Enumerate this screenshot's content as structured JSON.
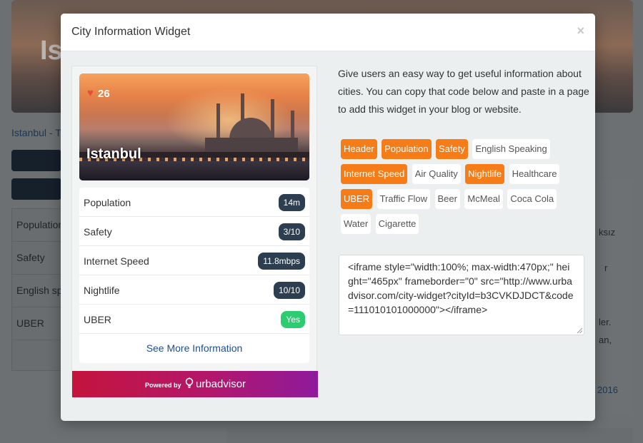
{
  "background": {
    "hero_title": "Ista",
    "breadcrumb": "Istanbul - T",
    "side_rows": [
      "Population",
      "Safety",
      "English sp",
      "UBER"
    ],
    "right_texts": [
      "ksız",
      "r",
      "ler.",
      "an,",
      "2016"
    ]
  },
  "modal": {
    "title": "City Information Widget",
    "close": "×"
  },
  "widget": {
    "likes": "26",
    "city": "Istanbul",
    "stats": [
      {
        "label": "Population",
        "value": "14m",
        "color": "#2c3e50"
      },
      {
        "label": "Safety",
        "value": "3/10",
        "color": "#2c3e50"
      },
      {
        "label": "Internet Speed",
        "value": "11.8mbps",
        "color": "#2c3e50"
      },
      {
        "label": "Nightlife",
        "value": "10/10",
        "color": "#2c3e50"
      },
      {
        "label": "UBER",
        "value": "Yes",
        "color": "#2ecc71"
      }
    ],
    "see_more": "See More Information",
    "powered_by": "Powered by",
    "brand": "urbadvisor"
  },
  "description": "Give users an easy way to get useful information about cities. You can copy that code below and paste in a page to add this widget in your blog or website.",
  "tags": [
    {
      "label": "Header",
      "active": true
    },
    {
      "label": "Population",
      "active": true
    },
    {
      "label": "Safety",
      "active": true
    },
    {
      "label": "English Speaking",
      "active": false
    },
    {
      "label": "Internet Speed",
      "active": true
    },
    {
      "label": "Air Quality",
      "active": false
    },
    {
      "label": "Nightlife",
      "active": true
    },
    {
      "label": "Healthcare",
      "active": false
    },
    {
      "label": "UBER",
      "active": true
    },
    {
      "label": "Traffic Flow",
      "active": false
    },
    {
      "label": "Beer",
      "active": false
    },
    {
      "label": "McMeal",
      "active": false
    },
    {
      "label": "Coca Cola",
      "active": false
    },
    {
      "label": "Water",
      "active": false
    },
    {
      "label": "Cigarette",
      "active": false
    }
  ],
  "colors": {
    "active_tag": "#f57c16",
    "badge_dark": "#2c3e50",
    "badge_green": "#2ecc71"
  },
  "embed_code": "<iframe style=\"width:100%; max-width:470px;\" height=\"465px\" frameborder=\"0\" src=\"http://www.urbadvisor.com/city-widget?cityId=b3CVKDJDCT&code=111010101000000\"></iframe>"
}
